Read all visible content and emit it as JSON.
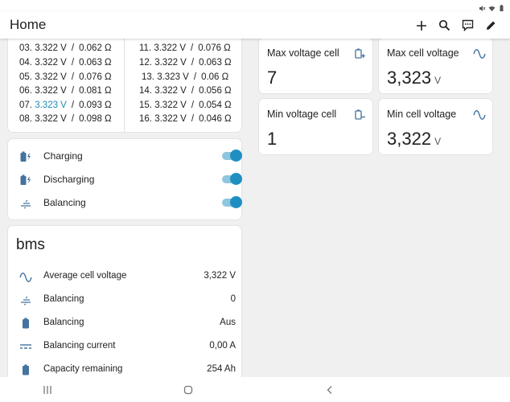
{
  "app": {
    "title": "Home"
  },
  "cells": {
    "left": [
      {
        "id": "03.",
        "voltage": "3.322 V",
        "resistance": "0.062 Ω"
      },
      {
        "id": "04.",
        "voltage": "3.322 V",
        "resistance": "0.063 Ω"
      },
      {
        "id": "05.",
        "voltage": "3.322 V",
        "resistance": "0.076 Ω"
      },
      {
        "id": "06.",
        "voltage": "3.322 V",
        "resistance": "0.081 Ω"
      },
      {
        "id": "07.",
        "voltage": "3.323 V",
        "resistance": "0.093 Ω",
        "highlight": true
      },
      {
        "id": "08.",
        "voltage": "3.322 V",
        "resistance": "0.098 Ω"
      }
    ],
    "right": [
      {
        "id": "11.",
        "voltage": "3.322 V",
        "resistance": "0.076 Ω"
      },
      {
        "id": "12.",
        "voltage": "3.322 V",
        "resistance": "0.063 Ω"
      },
      {
        "id": "13.",
        "voltage": "3.323 V",
        "resistance": "0.06 Ω"
      },
      {
        "id": "14.",
        "voltage": "3.322 V",
        "resistance": "0.056 Ω"
      },
      {
        "id": "15.",
        "voltage": "3.322 V",
        "resistance": "0.054 Ω"
      },
      {
        "id": "16.",
        "voltage": "3.322 V",
        "resistance": "0.046 Ω"
      }
    ],
    "separator": "/"
  },
  "switches": [
    {
      "label": "Charging",
      "icon": "battery-charging-icon",
      "on": true
    },
    {
      "label": "Discharging",
      "icon": "battery-discharging-icon",
      "on": true
    },
    {
      "label": "Balancing",
      "icon": "balance-scale-icon",
      "on": true
    }
  ],
  "bms": {
    "title": "bms",
    "entities": [
      {
        "label": "Average cell voltage",
        "value": "3,322 V",
        "icon": "sine-wave-icon"
      },
      {
        "label": "Balancing",
        "value": "0",
        "icon": "balance-scale-icon"
      },
      {
        "label": "Balancing",
        "value": "Aus",
        "icon": "battery-icon"
      },
      {
        "label": "Balancing current",
        "value": "0,00 A",
        "icon": "current-dc-icon"
      },
      {
        "label": "Capacity remaining",
        "value": "254 Ah",
        "icon": "battery-icon"
      }
    ]
  },
  "tiles": [
    {
      "name": "Max voltage cell",
      "value": "7",
      "unit": "",
      "icon": "battery-plus-icon"
    },
    {
      "name": "Max cell voltage",
      "value": "3,323",
      "unit": "V",
      "icon": "sine-wave-icon"
    },
    {
      "name": "Min voltage cell",
      "value": "1",
      "unit": "",
      "icon": "battery-minus-icon"
    },
    {
      "name": "Min cell voltage",
      "value": "3,322",
      "unit": "V",
      "icon": "sine-wave-icon"
    }
  ],
  "colors": {
    "accent": "#1f8fc1",
    "icon": "#44739e",
    "highlight": "#1e88b5"
  }
}
